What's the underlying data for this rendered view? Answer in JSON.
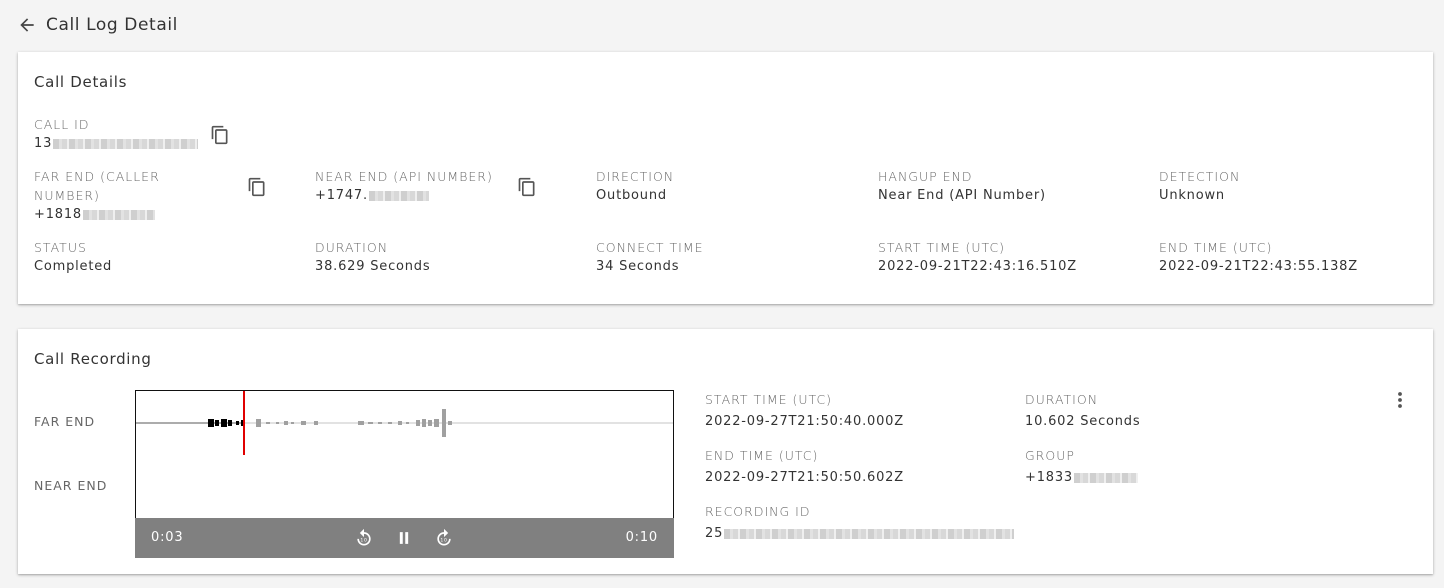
{
  "header": {
    "title": "Call Log Detail",
    "back_icon": "arrow-left-icon"
  },
  "call_details": {
    "title": "Call Details",
    "call_id": {
      "label": "CALL ID",
      "value": "13"
    },
    "far_end": {
      "label": "FAR END (CALLER NUMBER)",
      "value": "+1818"
    },
    "near_end": {
      "label": "NEAR END (API NUMBER)",
      "value": "+1747."
    },
    "direction": {
      "label": "DIRECTION",
      "value": "Outbound"
    },
    "hangup_end": {
      "label": "HANGUP END",
      "value": "Near End (API Number)"
    },
    "detection": {
      "label": "DETECTION",
      "value": "Unknown"
    },
    "status": {
      "label": "STATUS",
      "value": "Completed"
    },
    "duration": {
      "label": "DURATION",
      "value": "38.629 Seconds"
    },
    "connect_time": {
      "label": "CONNECT TIME",
      "value": "34 Seconds"
    },
    "start_time": {
      "label": "START TIME (UTC)",
      "value": "2022-09-21T22:43:16.510Z"
    },
    "end_time": {
      "label": "END TIME (UTC)",
      "value": "2022-09-21T22:43:55.138Z"
    }
  },
  "call_recording": {
    "title": "Call Recording",
    "tracks": [
      "FAR END",
      "NEAR END"
    ],
    "player": {
      "current_time": "0:03",
      "total_time": "0:10",
      "playback_progress": 0.2,
      "is_playing": true,
      "buttons": [
        "replay-10-icon",
        "pause-icon",
        "forward-10-icon"
      ]
    },
    "start_time": {
      "label": "START TIME (UTC)",
      "value": "2022-09-27T21:50:40.000Z"
    },
    "end_time": {
      "label": "END TIME (UTC)",
      "value": "2022-09-27T21:50:50.602Z"
    },
    "recording_id": {
      "label": "RECORDING ID",
      "value": "25"
    },
    "duration": {
      "label": "DURATION",
      "value": "10.602 Seconds"
    },
    "group": {
      "label": "GROUP",
      "value": "+1833"
    }
  },
  "colors": {
    "playhead": "#e00000",
    "controls_bg": "#808080",
    "page_bg": "#f4f4f4"
  }
}
